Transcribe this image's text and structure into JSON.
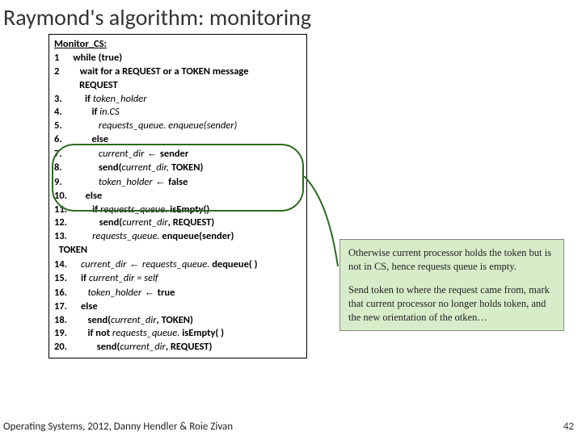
{
  "title": "Raymond's algorithm: monitoring",
  "code": {
    "header": "Monitor_CS:",
    "l1_num": "1",
    "l1_txt": "while (true)",
    "l2_num": "2",
    "l2_txt": "wait for a REQUEST or a TOKEN message",
    "req_label": "REQUEST",
    "l3_num": "3.",
    "l3_txt_if": "if ",
    "l3_txt_var": "token_holder",
    "l4_num": "4.",
    "l4_txt_if": "if ",
    "l4_txt_var": "in.CS",
    "l5_num": "5.",
    "l5_txt": "requests_queue. enqueue(sender)",
    "l6_num": "6.",
    "l6_txt": "else",
    "l7_num": "7.",
    "l7_var": "current_dir",
    "l7_arrow": " ← ",
    "l7_rhs": "sender",
    "l8_num": "8.",
    "l8_txt1": "send(",
    "l8_var": "current_dir,",
    "l8_txt2": " TOKEN)",
    "l9_num": "9.",
    "l9_var": "token_holder",
    "l9_arrow": " ← ",
    "l9_rhs": "false",
    "l10_num": "10.",
    "l10_txt": "else",
    "l11_num": "11.",
    "l11_txt_if": "if ",
    "l11_var": "requests_queue.",
    "l11_tail": " isEmpty()",
    "l12_num": "12.",
    "l12_txt1": "send(",
    "l12_var": "current_dir",
    "l12_txt2": ", REQUEST)",
    "l13_num": "13.",
    "l13_var": "requests_queue.",
    "l13_tail": " enqueue(sender)",
    "token_label": "TOKEN",
    "l14_num": "14.",
    "l14_var1": "current_dir",
    "l14_arrow": " ← ",
    "l14_var2": "requests_queue.",
    "l14_tail": " dequeue( )",
    "l15_num": "15.",
    "l15_txt_if": "if ",
    "l15_var": "current_dir = self",
    "l16_num": "16.",
    "l16_var": "token_holder",
    "l16_arrow": " ← ",
    "l16_rhs": "true",
    "l17_num": "17.",
    "l17_txt": "else",
    "l18_num": "18.",
    "l18_txt1": "send(",
    "l18_var": "current_dir",
    "l18_txt2": ", TOKEN)",
    "l19_num": "19.",
    "l19_txt_if": "if not ",
    "l19_var": "requests_queue.",
    "l19_tail": " isEmpty( )",
    "l20_num": "20.",
    "l20_txt1": "send(",
    "l20_var": "current_dir",
    "l20_txt2": ", REQUEST)"
  },
  "note": {
    "p1": "Otherwise current processor holds the token but is not in CS, hence requests queue is empty.",
    "p2": "Send token to where the request came from, mark that current processor no longer holds token, and the new orientation of the otken…"
  },
  "footer": "Operating Systems, 2012, Danny Hendler & Roie Zivan",
  "pagenum": "42"
}
